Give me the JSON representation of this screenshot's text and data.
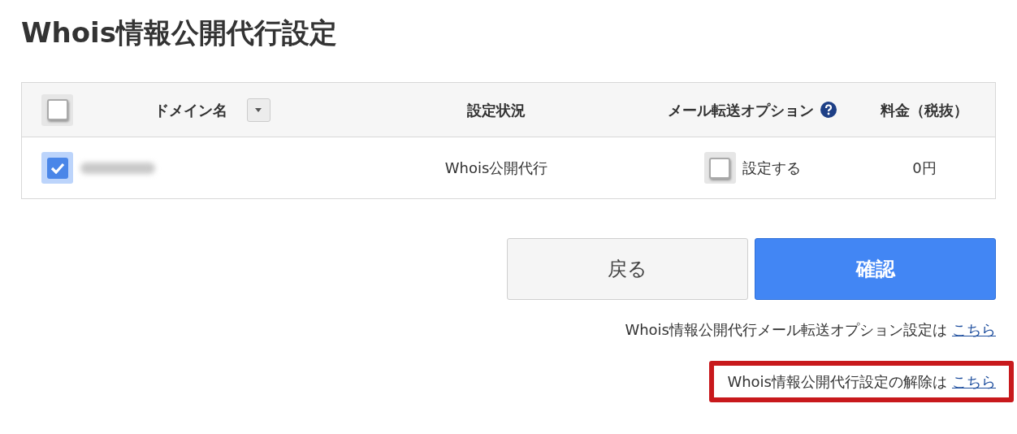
{
  "title": "Whois情報公開代行設定",
  "table": {
    "select_all": {
      "checked": false
    },
    "columns": [
      {
        "label": "ドメイン名",
        "kind": "sort"
      },
      {
        "label": "設定状況",
        "kind": "plain"
      },
      {
        "label": "メール転送オプション",
        "kind": "help"
      },
      {
        "label": "料金（税抜）",
        "kind": "plain"
      }
    ],
    "rows": [
      {
        "selected": true,
        "status": "Whois公開代行",
        "mail_option": {
          "label": "設定する",
          "checked": false
        },
        "price": "0円"
      }
    ]
  },
  "buttons": [
    {
      "label": "戻る",
      "kind": "secondary"
    },
    {
      "label": "確認",
      "kind": "primary"
    }
  ],
  "notes": [
    {
      "text": "Whois情報公開代行メール転送オプション設定は",
      "link": "こちら",
      "highlighted": false
    },
    {
      "text": "Whois情報公開代行設定の解除は",
      "link": "こちら",
      "highlighted": true
    }
  ]
}
